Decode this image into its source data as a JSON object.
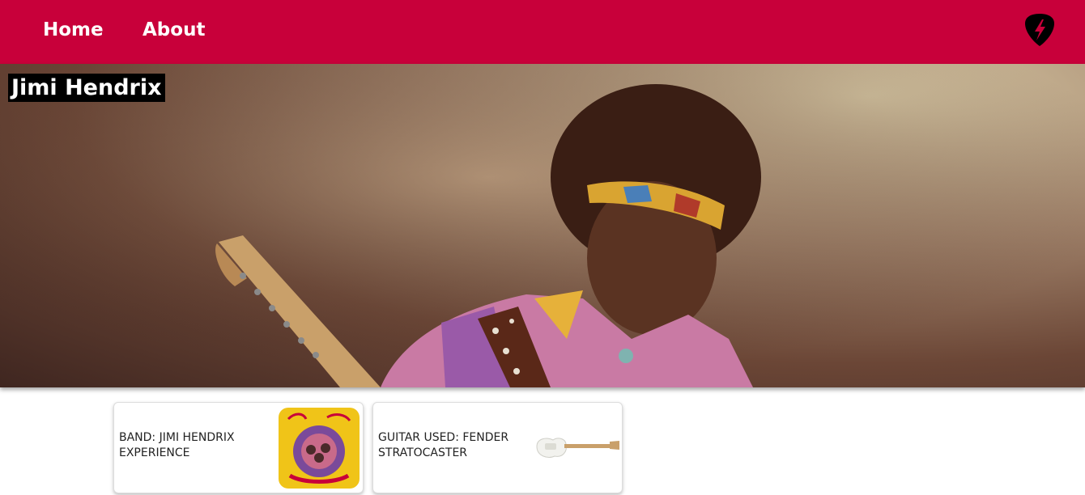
{
  "nav": {
    "items": [
      {
        "label": "Home"
      },
      {
        "label": "About"
      }
    ],
    "logo_icon": "guitar-pick-lightning-icon",
    "background": "#c8003a"
  },
  "hero": {
    "title": "Jimi Hendrix",
    "image": "jimi-hendrix-photo"
  },
  "cards": [
    {
      "label": "BAND: JIMI HENDRIX EXPERIENCE",
      "image": "album-cover"
    },
    {
      "label": "GUITAR USED: FENDER STRATOCASTER",
      "image": "fender-stratocaster"
    }
  ]
}
